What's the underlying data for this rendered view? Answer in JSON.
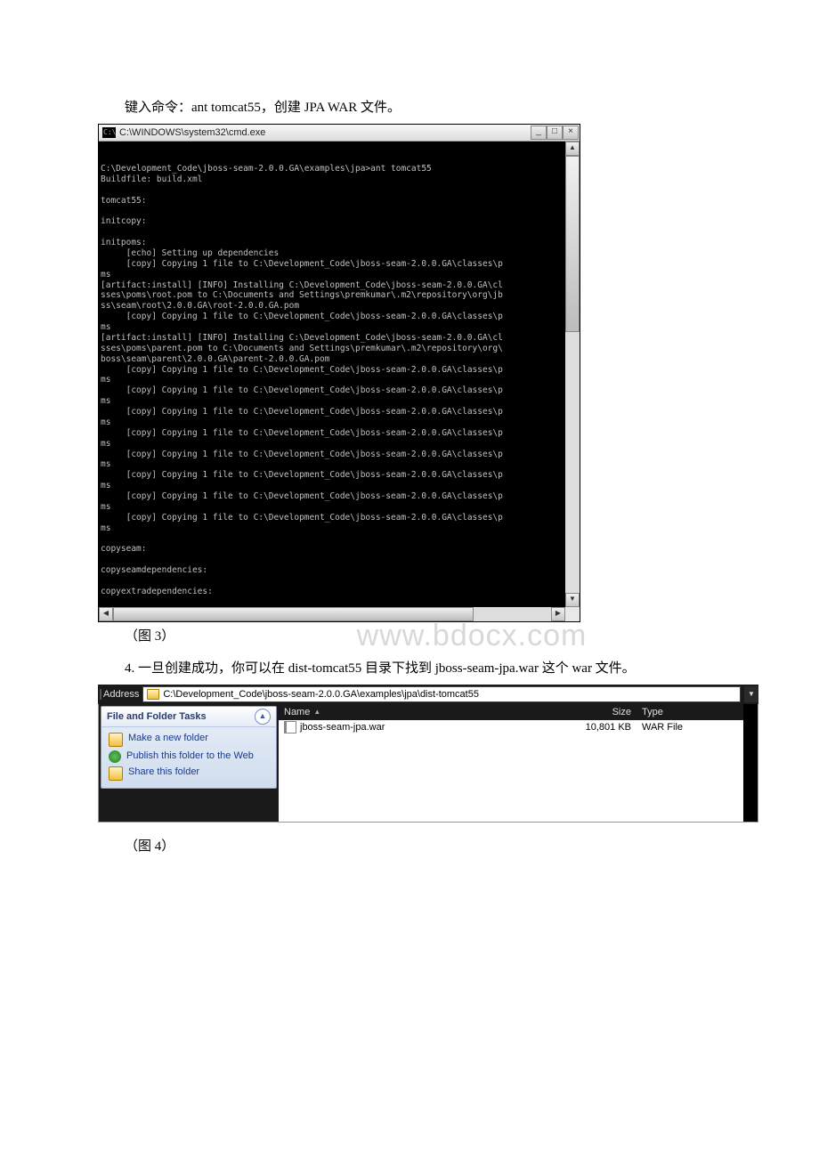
{
  "text": {
    "para1": "键入命令：ant tomcat55，创建 JPA WAR 文件。",
    "caption1": "（图 3）",
    "para2": "4. 一旦创建成功，你可以在 dist-tomcat55 目录下找到 jboss-seam-jpa.war 这个 war 文件。",
    "caption2": "（图 4）"
  },
  "watermark": "www.bdocx.com",
  "cmd": {
    "icon_text": "C:\\",
    "title": "C:\\WINDOWS\\system32\\cmd.exe",
    "min": "_",
    "max": "□",
    "close": "×",
    "up": "▲",
    "down": "▼",
    "left": "◀",
    "right": "▶",
    "body": "\nC:\\Development_Code\\jboss-seam-2.0.0.GA\\examples\\jpa>ant tomcat55\nBuildfile: build.xml\n\ntomcat55:\n\ninitcopy:\n\ninitpoms:\n     [echo] Setting up dependencies\n     [copy] Copying 1 file to C:\\Development_Code\\jboss-seam-2.0.0.GA\\classes\\p\nms\n[artifact:install] [INFO] Installing C:\\Development_Code\\jboss-seam-2.0.0.GA\\cl\nsses\\poms\\root.pom to C:\\Documents and Settings\\premkumar\\.m2\\repository\\org\\jb\nss\\seam\\root\\2.0.0.GA\\root-2.0.0.GA.pom\n     [copy] Copying 1 file to C:\\Development_Code\\jboss-seam-2.0.0.GA\\classes\\p\nms\n[artifact:install] [INFO] Installing C:\\Development_Code\\jboss-seam-2.0.0.GA\\cl\nsses\\poms\\parent.pom to C:\\Documents and Settings\\premkumar\\.m2\\repository\\org\\\nboss\\seam\\parent\\2.0.0.GA\\parent-2.0.0.GA.pom\n     [copy] Copying 1 file to C:\\Development_Code\\jboss-seam-2.0.0.GA\\classes\\p\nms\n     [copy] Copying 1 file to C:\\Development_Code\\jboss-seam-2.0.0.GA\\classes\\p\nms\n     [copy] Copying 1 file to C:\\Development_Code\\jboss-seam-2.0.0.GA\\classes\\p\nms\n     [copy] Copying 1 file to C:\\Development_Code\\jboss-seam-2.0.0.GA\\classes\\p\nms\n     [copy] Copying 1 file to C:\\Development_Code\\jboss-seam-2.0.0.GA\\classes\\p\nms\n     [copy] Copying 1 file to C:\\Development_Code\\jboss-seam-2.0.0.GA\\classes\\p\nms\n     [copy] Copying 1 file to C:\\Development_Code\\jboss-seam-2.0.0.GA\\classes\\p\nms\n     [copy] Copying 1 file to C:\\Development_Code\\jboss-seam-2.0.0.GA\\classes\\p\nms\n\ncopyseam:\n\ncopyseamdependencies:\n\ncopyextradependencies:\n\ninit:"
  },
  "explorer": {
    "address_label": "Address",
    "path": "C:\\Development_Code\\jboss-seam-2.0.0.GA\\examples\\jpa\\dist-tomcat55",
    "drop": "▼",
    "panel_title": "File and Folder Tasks",
    "collapse": "▲",
    "tasks": {
      "t1": "Make a new folder",
      "t2": "Publish this folder to the Web",
      "t3": "Share this folder"
    },
    "cols": {
      "name": "Name",
      "size": "Size",
      "type": "Type",
      "sort": "▲"
    },
    "file": {
      "name": "jboss-seam-jpa.war",
      "size": "10,801 KB",
      "type": "WAR File"
    }
  }
}
